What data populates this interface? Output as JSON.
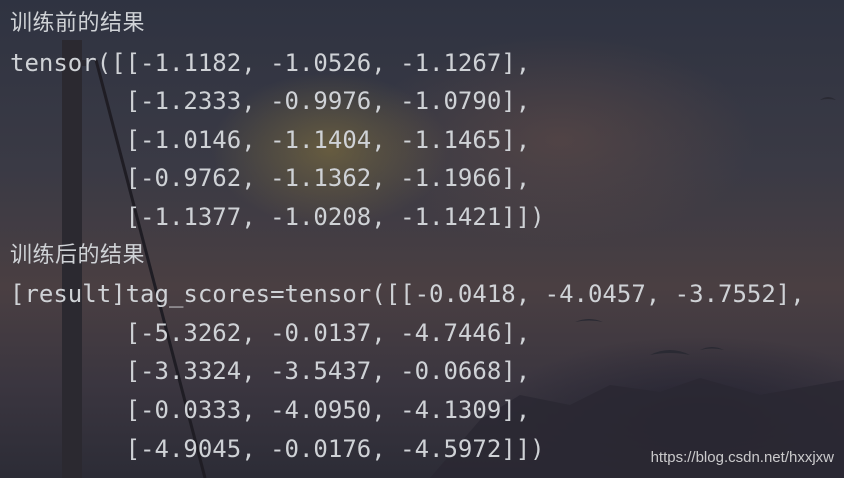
{
  "output": {
    "lines": [
      "训练前的结果",
      "tensor([[-1.1182, -1.0526, -1.1267],",
      "        [-1.2333, -0.9976, -1.0790],",
      "        [-1.0146, -1.1404, -1.1465],",
      "        [-0.9762, -1.1362, -1.1966],",
      "        [-1.1377, -1.0208, -1.1421]])",
      "训练后的结果",
      "[result]tag_scores=tensor([[-0.0418, -4.0457, -3.7552],",
      "        [-5.3262, -0.0137, -4.7446],",
      "        [-3.3324, -3.5437, -0.0668],",
      "        [-0.0333, -4.0950, -4.1309],",
      "        [-4.9045, -0.0176, -4.5972]])"
    ]
  },
  "watermark": "https://blog.csdn.net/hxxjxw",
  "colors": {
    "text": "#cfd2d6"
  }
}
